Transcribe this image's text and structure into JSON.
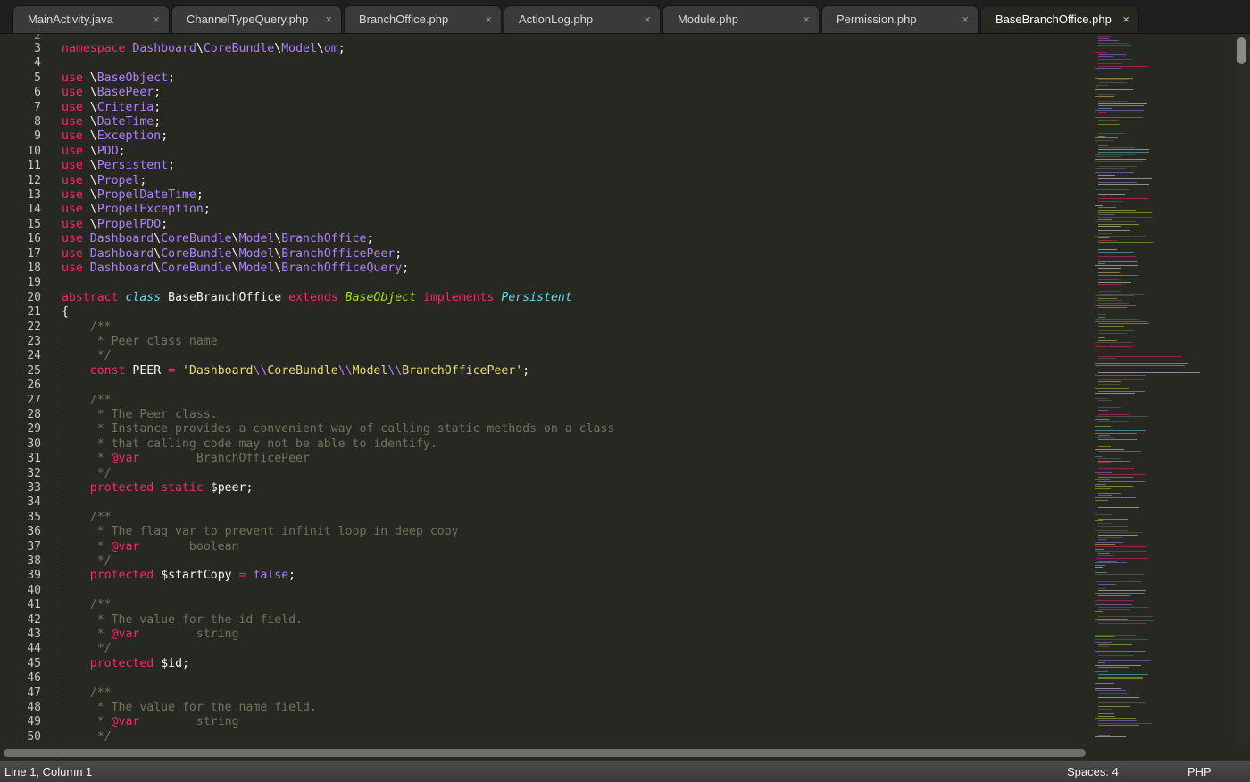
{
  "tabs": [
    {
      "label": "MainActivity.java",
      "close": "×"
    },
    {
      "label": "ChannelTypeQuery.php",
      "close": "×"
    },
    {
      "label": "BranchOffice.php",
      "close": "×"
    },
    {
      "label": "ActionLog.php",
      "close": "×"
    },
    {
      "label": "Module.php",
      "close": "×"
    },
    {
      "label": "Permission.php",
      "close": "×"
    },
    {
      "label": "BaseBranchOffice.php",
      "close": "×",
      "active": true
    }
  ],
  "editor": {
    "first_partial_line": "2",
    "lines": [
      {
        "n": "3",
        "t": [
          [
            "k",
            "namespace"
          ],
          [
            "p",
            " "
          ],
          [
            "n",
            "Dashboard"
          ],
          [
            "p",
            "\\"
          ],
          [
            "n",
            "CoreBundle"
          ],
          [
            "p",
            "\\"
          ],
          [
            "n",
            "Model"
          ],
          [
            "p",
            "\\"
          ],
          [
            "n",
            "om"
          ],
          [
            "p",
            ";"
          ]
        ]
      },
      {
        "n": "4",
        "t": []
      },
      {
        "n": "5",
        "t": [
          [
            "k",
            "use"
          ],
          [
            "p",
            " \\"
          ],
          [
            "n",
            "BaseObject"
          ],
          [
            "p",
            ";"
          ]
        ]
      },
      {
        "n": "6",
        "t": [
          [
            "k",
            "use"
          ],
          [
            "p",
            " \\"
          ],
          [
            "n",
            "BasePeer"
          ],
          [
            "p",
            ";"
          ]
        ]
      },
      {
        "n": "7",
        "t": [
          [
            "k",
            "use"
          ],
          [
            "p",
            " \\"
          ],
          [
            "n",
            "Criteria"
          ],
          [
            "p",
            ";"
          ]
        ]
      },
      {
        "n": "8",
        "t": [
          [
            "k",
            "use"
          ],
          [
            "p",
            " \\"
          ],
          [
            "n",
            "DateTime"
          ],
          [
            "p",
            ";"
          ]
        ]
      },
      {
        "n": "9",
        "t": [
          [
            "k",
            "use"
          ],
          [
            "p",
            " \\"
          ],
          [
            "n",
            "Exception"
          ],
          [
            "p",
            ";"
          ]
        ]
      },
      {
        "n": "10",
        "t": [
          [
            "k",
            "use"
          ],
          [
            "p",
            " \\"
          ],
          [
            "n",
            "PDO"
          ],
          [
            "p",
            ";"
          ]
        ]
      },
      {
        "n": "11",
        "t": [
          [
            "k",
            "use"
          ],
          [
            "p",
            " \\"
          ],
          [
            "n",
            "Persistent"
          ],
          [
            "p",
            ";"
          ]
        ]
      },
      {
        "n": "12",
        "t": [
          [
            "k",
            "use"
          ],
          [
            "p",
            " \\"
          ],
          [
            "n",
            "Propel"
          ],
          [
            "p",
            ";"
          ]
        ]
      },
      {
        "n": "13",
        "t": [
          [
            "k",
            "use"
          ],
          [
            "p",
            " \\"
          ],
          [
            "n",
            "PropelDateTime"
          ],
          [
            "p",
            ";"
          ]
        ]
      },
      {
        "n": "14",
        "t": [
          [
            "k",
            "use"
          ],
          [
            "p",
            " \\"
          ],
          [
            "n",
            "PropelException"
          ],
          [
            "p",
            ";"
          ]
        ]
      },
      {
        "n": "15",
        "t": [
          [
            "k",
            "use"
          ],
          [
            "p",
            " \\"
          ],
          [
            "n",
            "PropelPDO"
          ],
          [
            "p",
            ";"
          ]
        ]
      },
      {
        "n": "16",
        "t": [
          [
            "k",
            "use"
          ],
          [
            "p",
            " "
          ],
          [
            "n",
            "Dashboard"
          ],
          [
            "p",
            "\\"
          ],
          [
            "n",
            "CoreBundle"
          ],
          [
            "p",
            "\\"
          ],
          [
            "n",
            "Model"
          ],
          [
            "p",
            "\\"
          ],
          [
            "n",
            "BranchOffice"
          ],
          [
            "p",
            ";"
          ]
        ]
      },
      {
        "n": "17",
        "t": [
          [
            "k",
            "use"
          ],
          [
            "p",
            " "
          ],
          [
            "n",
            "Dashboard"
          ],
          [
            "p",
            "\\"
          ],
          [
            "n",
            "CoreBundle"
          ],
          [
            "p",
            "\\"
          ],
          [
            "n",
            "Model"
          ],
          [
            "p",
            "\\"
          ],
          [
            "n",
            "BranchOfficePeer"
          ],
          [
            "p",
            ";"
          ]
        ]
      },
      {
        "n": "18",
        "t": [
          [
            "k",
            "use"
          ],
          [
            "p",
            " "
          ],
          [
            "n",
            "Dashboard"
          ],
          [
            "p",
            "\\"
          ],
          [
            "n",
            "CoreBundle"
          ],
          [
            "p",
            "\\"
          ],
          [
            "n",
            "Model"
          ],
          [
            "p",
            "\\"
          ],
          [
            "n",
            "BranchOfficeQuery"
          ],
          [
            "p",
            ";"
          ]
        ]
      },
      {
        "n": "19",
        "t": []
      },
      {
        "n": "20",
        "t": [
          [
            "k",
            "abstract"
          ],
          [
            "p",
            " "
          ],
          [
            "i",
            "class"
          ],
          [
            "p",
            " "
          ],
          [
            "cl",
            "BaseBranchOffice"
          ],
          [
            "p",
            " "
          ],
          [
            "k",
            "extends"
          ],
          [
            "p",
            " "
          ],
          [
            "g",
            "BaseObject"
          ],
          [
            "p",
            " "
          ],
          [
            "k",
            "implements"
          ],
          [
            "p",
            " "
          ],
          [
            "i",
            "Persistent"
          ]
        ]
      },
      {
        "n": "21",
        "t": [
          [
            "p",
            "{"
          ]
        ]
      },
      {
        "n": "22",
        "t": [
          [
            "p",
            "    "
          ],
          [
            "c",
            "/**"
          ]
        ]
      },
      {
        "n": "23",
        "t": [
          [
            "p",
            "    "
          ],
          [
            "c",
            " * Peer class name"
          ]
        ]
      },
      {
        "n": "24",
        "t": [
          [
            "p",
            "    "
          ],
          [
            "c",
            " */"
          ]
        ]
      },
      {
        "n": "25",
        "t": [
          [
            "p",
            "    "
          ],
          [
            "k",
            "const"
          ],
          [
            "p",
            " PEER "
          ],
          [
            "k",
            "="
          ],
          [
            "p",
            " "
          ],
          [
            "s",
            "'Dashboard"
          ],
          [
            "e",
            "\\\\"
          ],
          [
            "s",
            "CoreBundle"
          ],
          [
            "e",
            "\\\\"
          ],
          [
            "s",
            "Model"
          ],
          [
            "e",
            "\\\\"
          ],
          [
            "s",
            "BranchOfficePeer'"
          ],
          [
            "p",
            ";"
          ]
        ]
      },
      {
        "n": "26",
        "t": []
      },
      {
        "n": "27",
        "t": [
          [
            "p",
            "    "
          ],
          [
            "c",
            "/**"
          ]
        ]
      },
      {
        "n": "28",
        "t": [
          [
            "p",
            "    "
          ],
          [
            "c",
            " * The Peer class."
          ]
        ]
      },
      {
        "n": "29",
        "t": [
          [
            "p",
            "    "
          ],
          [
            "c",
            " * Instance provides a convenient way of calling static methods on a class"
          ]
        ]
      },
      {
        "n": "30",
        "t": [
          [
            "p",
            "    "
          ],
          [
            "c",
            " * that calling code may not be able to identify."
          ]
        ]
      },
      {
        "n": "31",
        "t": [
          [
            "p",
            "    "
          ],
          [
            "c",
            " * "
          ],
          [
            "k",
            "@var"
          ],
          [
            "c",
            "        BranchOfficePeer"
          ]
        ]
      },
      {
        "n": "32",
        "t": [
          [
            "p",
            "    "
          ],
          [
            "c",
            " */"
          ]
        ]
      },
      {
        "n": "33",
        "t": [
          [
            "p",
            "    "
          ],
          [
            "k",
            "protected"
          ],
          [
            "p",
            " "
          ],
          [
            "k",
            "static"
          ],
          [
            "p",
            " "
          ],
          [
            "v",
            "$peer"
          ],
          [
            "p",
            ";"
          ]
        ]
      },
      {
        "n": "34",
        "t": []
      },
      {
        "n": "35",
        "t": [
          [
            "p",
            "    "
          ],
          [
            "c",
            "/**"
          ]
        ]
      },
      {
        "n": "36",
        "t": [
          [
            "p",
            "    "
          ],
          [
            "c",
            " * The flag var to prevent infinit loop in deep copy"
          ]
        ]
      },
      {
        "n": "37",
        "t": [
          [
            "p",
            "    "
          ],
          [
            "c",
            " * "
          ],
          [
            "k",
            "@var"
          ],
          [
            "c",
            "       boolean"
          ]
        ]
      },
      {
        "n": "38",
        "t": [
          [
            "p",
            "    "
          ],
          [
            "c",
            " */"
          ]
        ]
      },
      {
        "n": "39",
        "t": [
          [
            "p",
            "    "
          ],
          [
            "k",
            "protected"
          ],
          [
            "p",
            " "
          ],
          [
            "v",
            "$startCopy"
          ],
          [
            "p",
            " "
          ],
          [
            "k",
            "="
          ],
          [
            "p",
            " "
          ],
          [
            "n",
            "false"
          ],
          [
            "p",
            ";"
          ]
        ]
      },
      {
        "n": "40",
        "t": []
      },
      {
        "n": "41",
        "t": [
          [
            "p",
            "    "
          ],
          [
            "c",
            "/**"
          ]
        ]
      },
      {
        "n": "42",
        "t": [
          [
            "p",
            "    "
          ],
          [
            "c",
            " * The value for the id field."
          ]
        ]
      },
      {
        "n": "43",
        "t": [
          [
            "p",
            "    "
          ],
          [
            "c",
            " * "
          ],
          [
            "k",
            "@var"
          ],
          [
            "c",
            "        string"
          ]
        ]
      },
      {
        "n": "44",
        "t": [
          [
            "p",
            "    "
          ],
          [
            "c",
            " */"
          ]
        ]
      },
      {
        "n": "45",
        "t": [
          [
            "p",
            "    "
          ],
          [
            "k",
            "protected"
          ],
          [
            "p",
            " "
          ],
          [
            "v",
            "$id"
          ],
          [
            "p",
            ";"
          ]
        ]
      },
      {
        "n": "46",
        "t": []
      },
      {
        "n": "47",
        "t": [
          [
            "p",
            "    "
          ],
          [
            "c",
            "/**"
          ]
        ]
      },
      {
        "n": "48",
        "t": [
          [
            "p",
            "    "
          ],
          [
            "c",
            " * The value for the name field."
          ]
        ]
      },
      {
        "n": "49",
        "t": [
          [
            "p",
            "    "
          ],
          [
            "c",
            " * "
          ],
          [
            "k",
            "@var"
          ],
          [
            "c",
            "        string"
          ]
        ]
      },
      {
        "n": "50",
        "t": [
          [
            "p",
            "    "
          ],
          [
            "c",
            " */"
          ]
        ]
      }
    ]
  },
  "colors": {
    "background": "#272822",
    "keyword": "#f92672",
    "constant": "#ae81ff",
    "string": "#e6db74",
    "comment": "#75715e",
    "type": "#66d9ef",
    "inherited": "#a6e22e"
  },
  "status": {
    "position": "Line 1, Column 1",
    "indentation": "Spaces: 4",
    "syntax": "PHP"
  }
}
